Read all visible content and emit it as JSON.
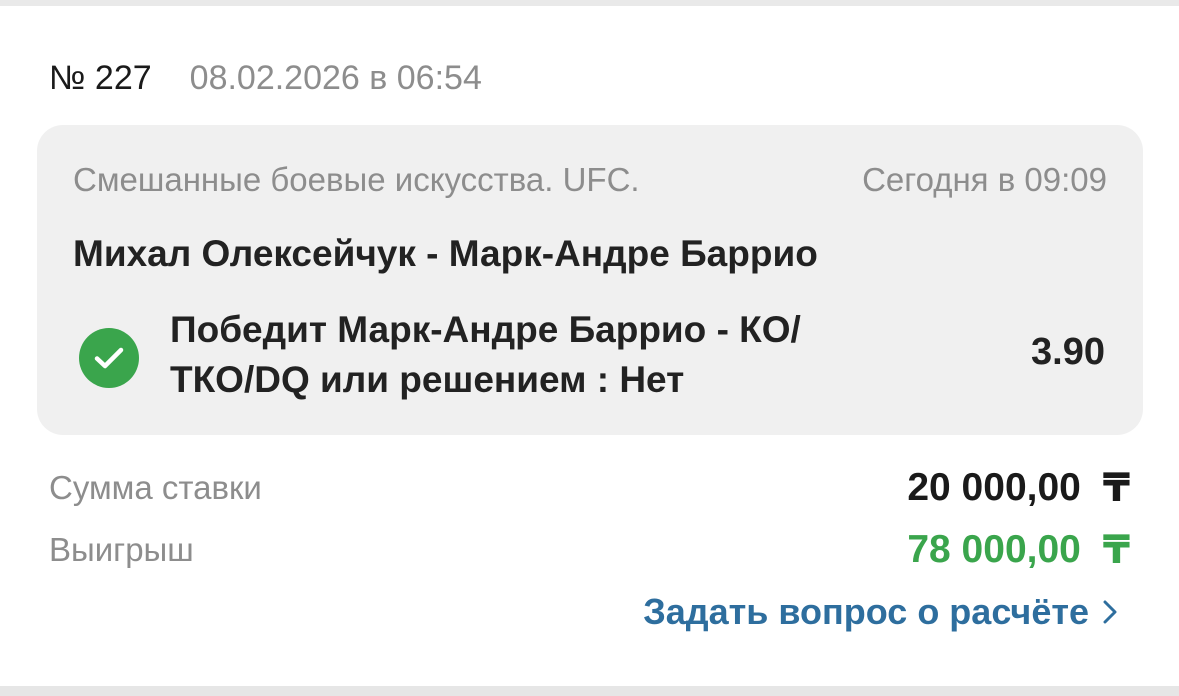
{
  "bet": {
    "number": "№ 227",
    "placed_at": "08.02.2026 в 06:54"
  },
  "event": {
    "category": "Смешанные боевые искусства. UFC.",
    "start_time": "Сегодня в 09:09",
    "title": "Михал Олексейчук - Марк-Андре Баррио",
    "status_icon": "check-circle-icon",
    "outcome": "Победит Марк-Андре Баррио - КО/ ТКО/DQ или решением : Нет",
    "odds": "3.90"
  },
  "summary": {
    "stake_label": "Сумма ставки",
    "stake_value": "20 000,00",
    "win_label": "Выигрыш",
    "win_value": "78 000,00",
    "currency": "₸"
  },
  "actions": {
    "ask_question": "Задать вопрос о расчёте",
    "ask_question_icon": "chevron-right-icon"
  },
  "colors": {
    "success": "#3aa54c",
    "link": "#2e6e9e",
    "muted": "#8d8d8d",
    "card_bg": "#f0f0f0"
  }
}
